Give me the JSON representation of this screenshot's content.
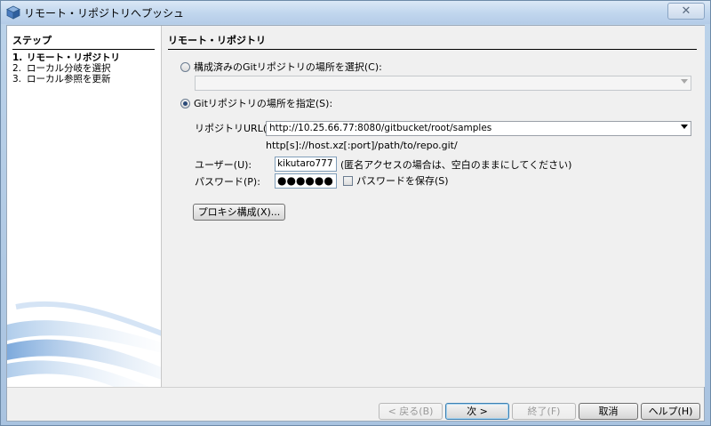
{
  "window": {
    "title": "リモート・リポジトリへプッシュ",
    "close_label": "✕"
  },
  "steps": {
    "title": "ステップ",
    "items": [
      {
        "num": "1.",
        "label": "リモート・リポジトリ",
        "active": true
      },
      {
        "num": "2.",
        "label": "ローカル分岐を選択",
        "active": false
      },
      {
        "num": "3.",
        "label": "ローカル参照を更新",
        "active": false
      }
    ]
  },
  "panel": {
    "title": "リモート・リポジトリ",
    "option_configured": {
      "label": "構成済みのGitリポジトリの場所を選択(C):",
      "selected": false,
      "combo_value": ""
    },
    "option_specify": {
      "label": "Gitリポジトリの場所を指定(S):",
      "selected": true
    },
    "repo_url": {
      "label": "リポジトリURL(R):",
      "value": "http://10.25.66.77:8080/gitbucket/root/samples",
      "hint": "http[s]://host.xz[:port]/path/to/repo.git/"
    },
    "user": {
      "label": "ユーザー(U):",
      "value": "kikutaro777",
      "note": "(匿名アクセスの場合は、空白のままにしてください)"
    },
    "password": {
      "label": "パスワード(P):",
      "value": "●●●●●●",
      "save_label": "パスワードを保存(S)",
      "save_checked": false
    },
    "proxy_button": "プロキシ構成(X)..."
  },
  "buttons": {
    "back": "< 戻る(B)",
    "next": "次 >",
    "finish": "終了(F)",
    "cancel": "取消",
    "help": "ヘルプ(H)"
  }
}
